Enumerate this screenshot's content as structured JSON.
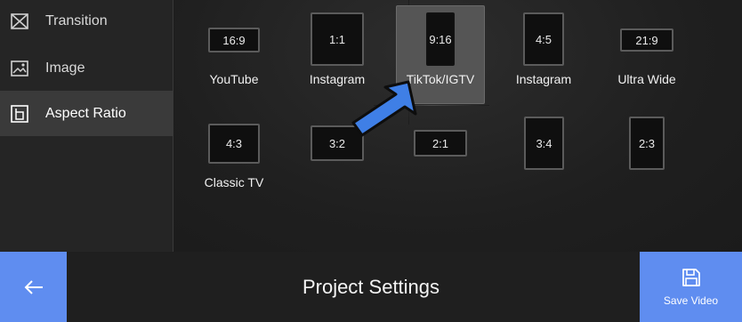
{
  "sidebar": {
    "items": [
      {
        "label": "Transition",
        "icon": "transition-icon",
        "active": false
      },
      {
        "label": "Image",
        "icon": "image-icon",
        "active": false
      },
      {
        "label": "Aspect Ratio",
        "icon": "aspect-ratio-icon",
        "active": true
      }
    ]
  },
  "ratios": [
    {
      "ratio": "16:9",
      "label": "YouTube",
      "selected": false
    },
    {
      "ratio": "1:1",
      "label": "Instagram",
      "selected": false
    },
    {
      "ratio": "9:16",
      "label": "TikTok/IGTV",
      "selected": true
    },
    {
      "ratio": "4:5",
      "label": "Instagram",
      "selected": false
    },
    {
      "ratio": "21:9",
      "label": "Ultra Wide",
      "selected": false
    },
    {
      "ratio": "4:3",
      "label": "Classic TV",
      "selected": false
    },
    {
      "ratio": "3:2",
      "label": "",
      "selected": false
    },
    {
      "ratio": "2:1",
      "label": "",
      "selected": false
    },
    {
      "ratio": "3:4",
      "label": "",
      "selected": false
    },
    {
      "ratio": "2:3",
      "label": "",
      "selected": false
    }
  ],
  "footer": {
    "title": "Project Settings",
    "save_label": "Save Video",
    "back_icon": "arrow-left-icon",
    "save_icon": "save-icon"
  },
  "colors": {
    "accent": "#5f8df0",
    "pointer_arrow": "#3f7fe6"
  }
}
